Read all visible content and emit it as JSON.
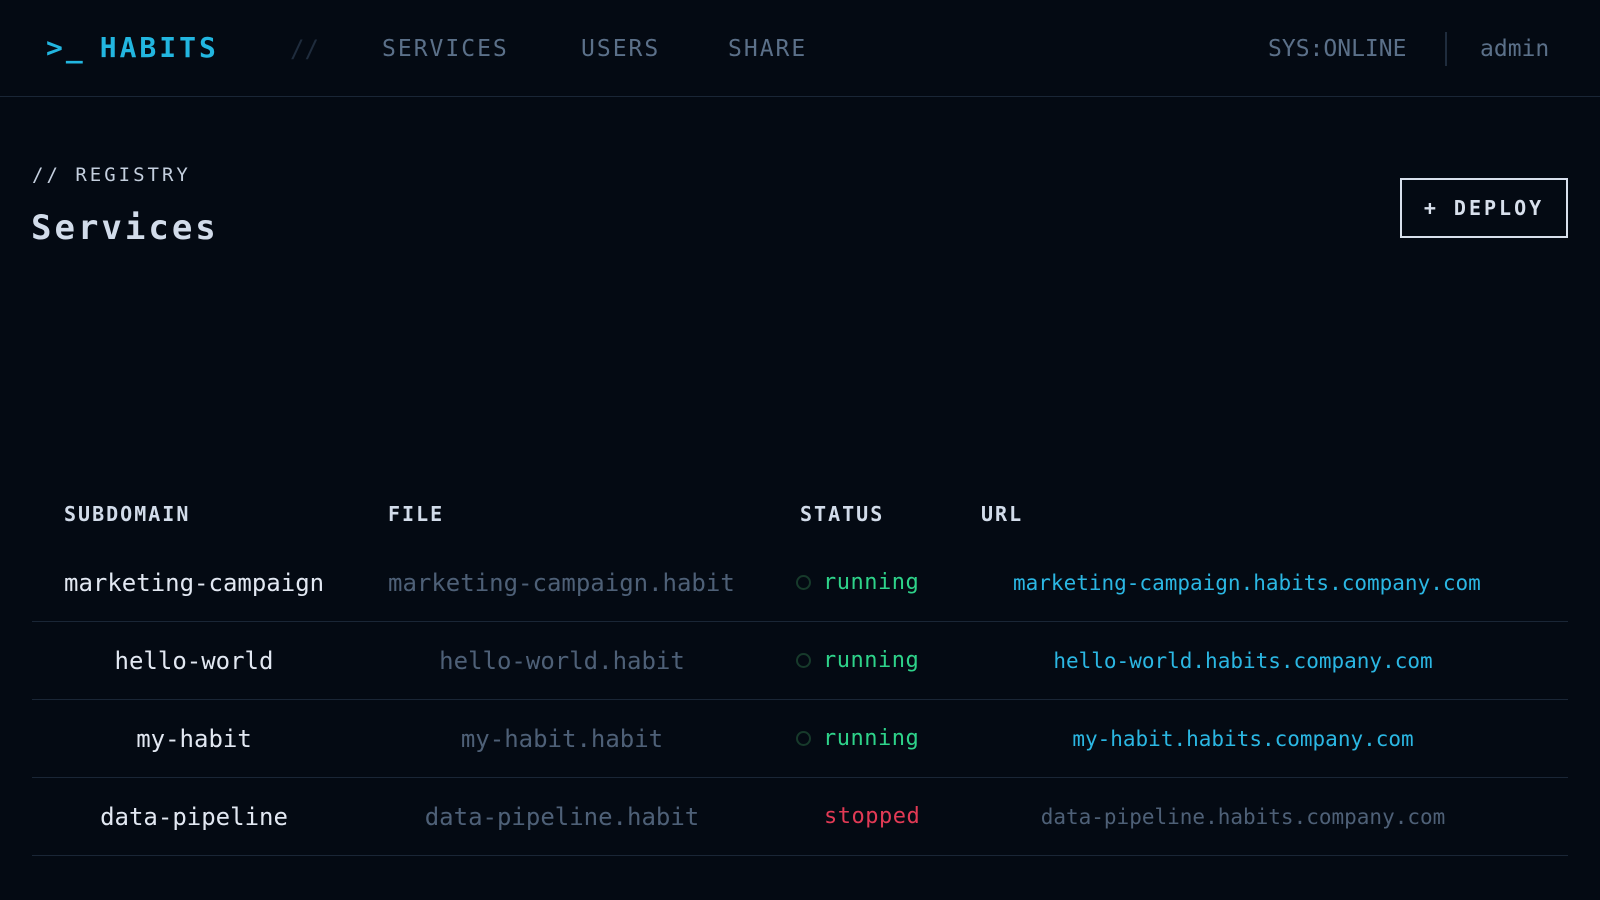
{
  "brand": {
    "prompt": ">_",
    "name": "HABITS",
    "accent_color": "#22b6e0"
  },
  "nav": {
    "separator": "//",
    "items": [
      {
        "label": "SERVICES"
      },
      {
        "label": "USERS"
      },
      {
        "label": "SHARE"
      }
    ]
  },
  "system": {
    "status": "SYS:ONLINE",
    "user": "admin"
  },
  "page": {
    "kicker": "// REGISTRY",
    "title": "Services",
    "deploy_label": "+ DEPLOY"
  },
  "table": {
    "columns": [
      "SUBDOMAIN",
      "FILE",
      "STATUS",
      "URL"
    ],
    "rows": [
      {
        "subdomain": "marketing-campaign",
        "file": "marketing-campaign.habit",
        "status": "running",
        "url": "marketing-campaign.habits.company.com"
      },
      {
        "subdomain": "hello-world",
        "file": "hello-world.habit",
        "status": "running",
        "url": "hello-world.habits.company.com"
      },
      {
        "subdomain": "my-habit",
        "file": "my-habit.habit",
        "status": "running",
        "url": "my-habit.habits.company.com"
      },
      {
        "subdomain": "data-pipeline",
        "file": "data-pipeline.habit",
        "status": "stopped",
        "url": "data-pipeline.habits.company.com"
      }
    ]
  },
  "colors": {
    "background": "#040a13",
    "running": "#2ed38a",
    "stopped": "#e23a55",
    "link": "#2bb7e3",
    "muted": "#4e6077"
  },
  "icons": {
    "status_indicator": "status-dot-icon"
  }
}
